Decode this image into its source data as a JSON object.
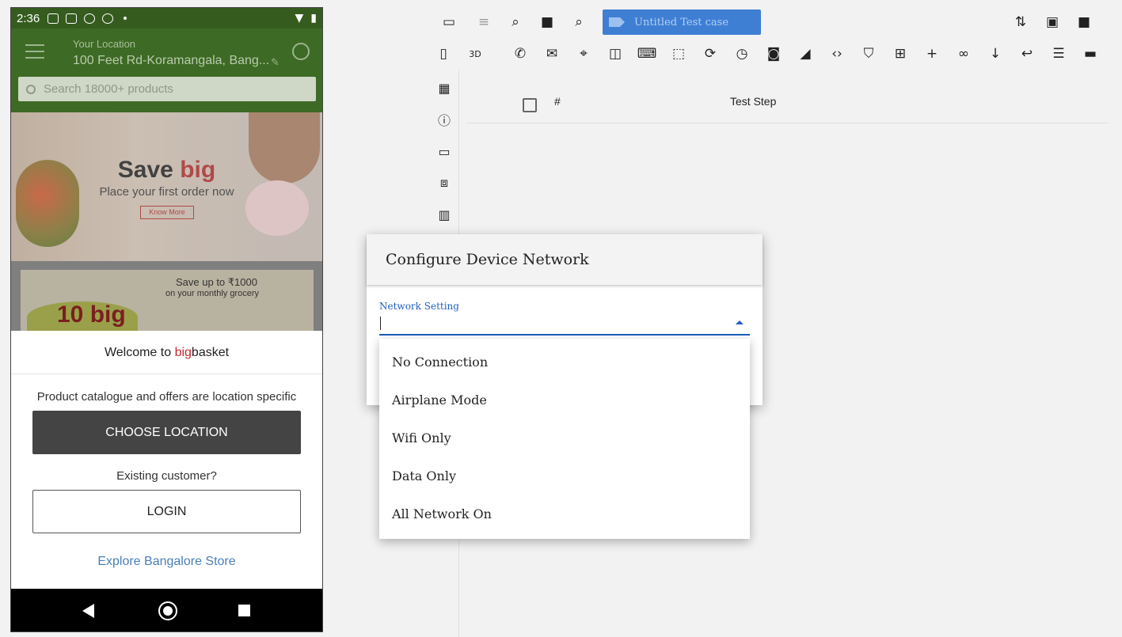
{
  "phone": {
    "status_time": "2:36",
    "header": {
      "location_title": "Your Location",
      "location_value": "100 Feet Rd-Koramangala, Bang...",
      "search_placeholder": "Search 18000+ products"
    },
    "banner1": {
      "title_a": "Save ",
      "title_b": "big",
      "subtitle": "Place your first order now",
      "button": "Know More"
    },
    "banner2": {
      "text": "Save up to ₹1000",
      "sub": "on your monthly grocery",
      "big": "10 big"
    },
    "welcome": {
      "title_a": "Welcome to ",
      "title_b": "big",
      "title_c": "basket",
      "note": "Product catalogue and offers are location specific",
      "choose_button": "CHOOSE LOCATION",
      "existing": "Existing customer?",
      "login_button": "LOGIN",
      "explore_link": "Explore Bangalore Store"
    }
  },
  "editor": {
    "testcase_name": "Untitled Test case",
    "steps_table": {
      "col_hash": "#",
      "col_step": "Test Step"
    }
  },
  "dialog": {
    "title": "Configure Device Network",
    "field_label": "Network Setting",
    "options": [
      "No Connection",
      "Airplane Mode",
      "Wifi Only",
      "Data Only",
      "All Network On"
    ]
  },
  "colors": {
    "accent": "#1f5fbf",
    "chip": "#3e7fd4",
    "phone_header": "#3d6a24"
  }
}
